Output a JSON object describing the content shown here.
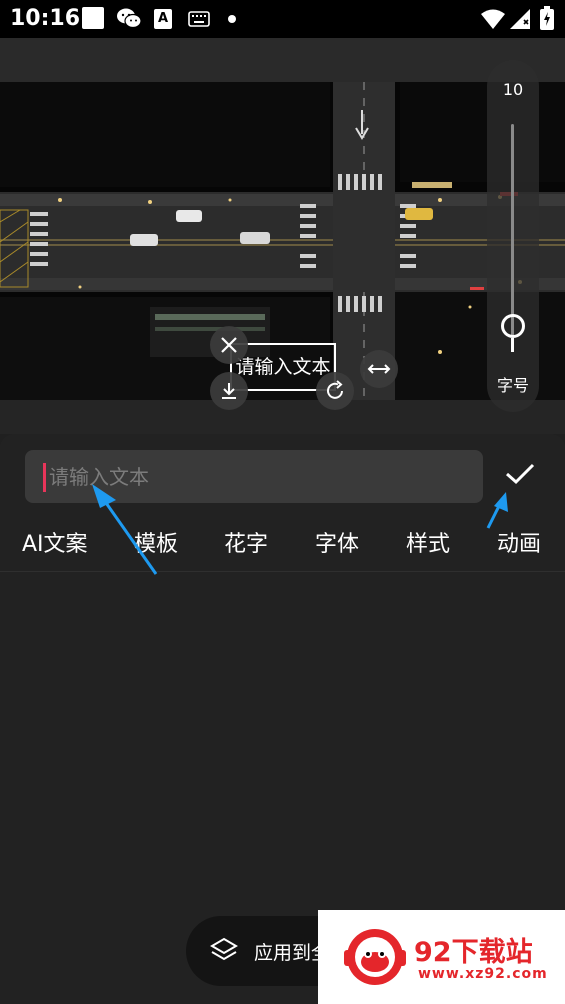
{
  "status_bar": {
    "time": "10:16",
    "icons": [
      "image-thumb-icon",
      "wechat-icon",
      "text-a-icon",
      "keyboard-icon",
      "dot-icon",
      "wifi-icon",
      "signal-icon",
      "battery-icon"
    ],
    "a_glyph": "A"
  },
  "size_slider": {
    "value": "10",
    "label": "字号",
    "level_fraction": 0.1
  },
  "text_box": {
    "text": "请输入文本"
  },
  "text_controls": [
    "close-icon",
    "download-icon",
    "rotate-icon",
    "stretch-arrows-icon"
  ],
  "input": {
    "placeholder": "请输入文本",
    "value": ""
  },
  "tabs": [
    {
      "label": "AI文案"
    },
    {
      "label": "模板"
    },
    {
      "label": "花字"
    },
    {
      "label": "字体"
    },
    {
      "label": "样式"
    },
    {
      "label": "动画"
    }
  ],
  "apply": {
    "label": "应用到全部"
  },
  "watermark": {
    "name": "92下载站",
    "url": "www.xz92.com"
  },
  "colors": {
    "accent_caret": "#e8355a",
    "arrow": "#1e9af0",
    "watermark_red": "#e4262b",
    "panel_bg": "#222222"
  }
}
